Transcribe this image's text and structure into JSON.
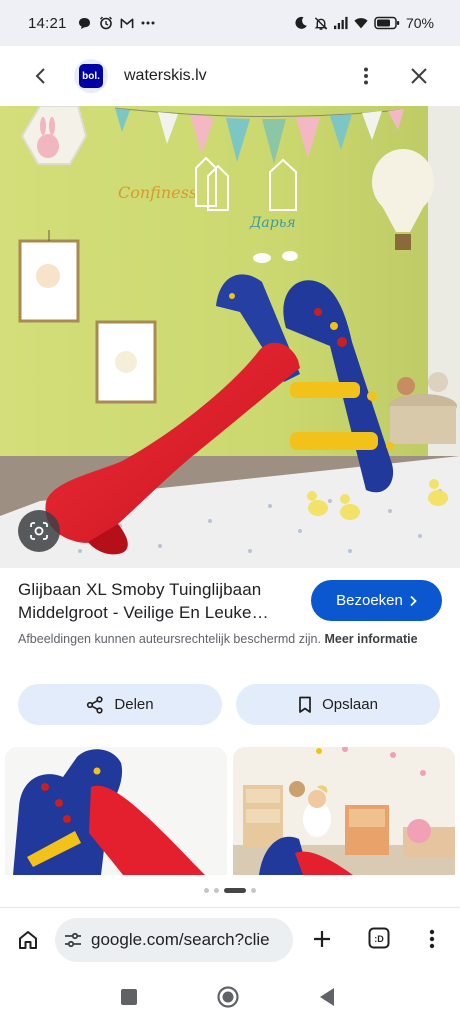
{
  "status_bar": {
    "time": "14:21",
    "battery": "70%",
    "left_icons": [
      "chat-bubble-icon",
      "alarm-icon",
      "gmail-icon",
      "more-dots-icon"
    ],
    "right_icons": [
      "moon-icon",
      "bell-off-icon",
      "signal-icon",
      "wifi-icon",
      "battery-icon"
    ]
  },
  "header": {
    "site": "waterskis.lv",
    "favicon_text": "bol."
  },
  "result": {
    "title": "Glijbaan XL Smoby Tuinglijbaan Middelgroot - Veilige En Leuke…",
    "visit_label": "Bezoeken",
    "copyright_text": "Afbeeldingen kunnen auteursrechtelijk beschermd zijn.",
    "copyright_more": "Meer informatie"
  },
  "actions": {
    "share_label": "Delen",
    "save_label": "Opslaan"
  },
  "browser": {
    "url": "google.com/search?clie"
  },
  "colors": {
    "accent": "#0b57d0",
    "action_bg": "#e3ecfa",
    "status_bg": "#eef0f6",
    "slide_red": "#e5202e",
    "slide_blue": "#21399a",
    "ladder_yellow": "#f2c21b"
  }
}
